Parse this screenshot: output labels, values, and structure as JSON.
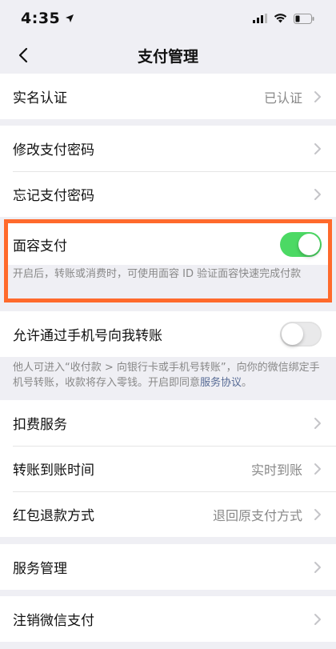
{
  "status_bar": {
    "time": "4:35"
  },
  "nav": {
    "title": "支付管理"
  },
  "groups": {
    "real_name": {
      "label": "实名认证",
      "value": "已认证"
    },
    "password": [
      {
        "label": "修改支付密码"
      },
      {
        "label": "忘记支付密码"
      }
    ],
    "face_pay": {
      "label": "面容支付",
      "enabled": true,
      "description": "开启后，转账或消费时，可使用面容 ID 验证面容快速完成付款"
    },
    "phone_transfer": {
      "label": "允许通过手机号向我转账",
      "enabled": false,
      "description_before": "他人可进入“收付款 > 向银行卡或手机号转账”，向你的微信绑定手机号转账，收款将存入零钱。开启即同意",
      "description_link": "服务协议",
      "description_after": "。"
    },
    "services": [
      {
        "label": "扣费服务",
        "value": ""
      },
      {
        "label": "转账到账时间",
        "value": "实时到账"
      },
      {
        "label": "红包退款方式",
        "value": "退回原支付方式"
      }
    ],
    "service_manage": {
      "label": "服务管理"
    },
    "cancel_pay": {
      "label": "注销微信支付"
    }
  },
  "colors": {
    "toggle_on": "#4cd964",
    "highlight": "#ff6a2c",
    "link": "#576b95"
  }
}
